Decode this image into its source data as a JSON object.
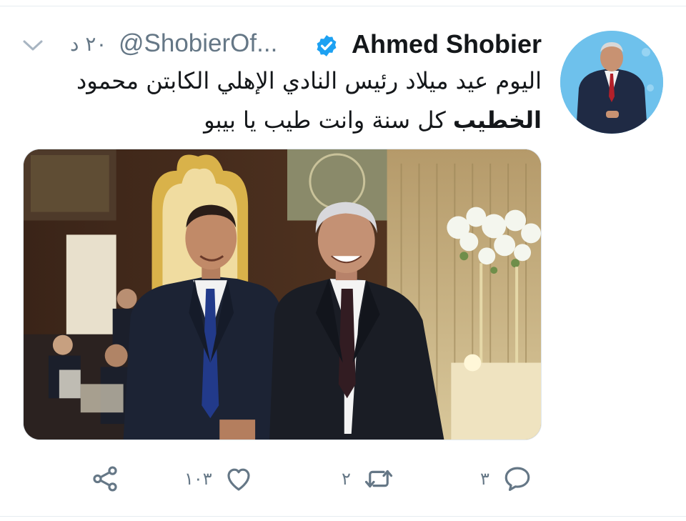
{
  "tweet": {
    "author_name": "Ahmed Shobier",
    "handle": "@ShobierOf...",
    "time": "٢٠ د",
    "text_line1": "اليوم عيد ميلاد رئيس النادي الإهلي الكابتن محمود",
    "text_bold": "الخطيب",
    "text_line2_rest": " كل سنة وانت طيب يا بيبو",
    "verified": true
  },
  "actions": {
    "reply_count": "٣",
    "retweet_count": "٢",
    "like_count": "١٠٣"
  },
  "icons": {
    "verified": "verified-badge-icon",
    "chevron": "chevron-down-icon",
    "reply": "reply-icon",
    "retweet": "retweet-icon",
    "like": "heart-icon",
    "share": "share-icon"
  },
  "colors": {
    "accent": "#1da1f2",
    "secondary_text": "#657786",
    "primary_text": "#14171a"
  }
}
